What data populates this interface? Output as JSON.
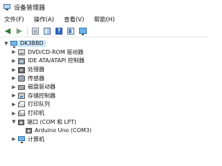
{
  "window": {
    "title": "设备管理器",
    "icon": "device-manager-icon"
  },
  "menu": [
    {
      "label": "文件(F)"
    },
    {
      "label": "操作(A)"
    },
    {
      "label": "查看(V)"
    },
    {
      "label": "帮助(H)"
    }
  ],
  "toolbar": {
    "buttons": [
      "back-arrow-icon",
      "forward-arrow-icon",
      "show-hide-tree-icon",
      "properties-icon",
      "help-icon",
      "update-driver-icon",
      "monitor-icon"
    ]
  },
  "tree": {
    "root": {
      "label": "DK3BBD",
      "expanded": true
    },
    "nodes": [
      {
        "label": "DVD/CD-ROM 驱动器",
        "expanded": false,
        "icon": "dvd-drive-icon"
      },
      {
        "label": "IDE ATA/ATAPI 控制器",
        "expanded": false,
        "icon": "ide-controller-icon"
      },
      {
        "label": "处理器",
        "expanded": false,
        "icon": "processor-icon"
      },
      {
        "label": "传感器",
        "expanded": false,
        "icon": "sensor-icon"
      },
      {
        "label": "磁盘驱动器",
        "expanded": false,
        "icon": "disk-drive-icon"
      },
      {
        "label": "存储控制器",
        "expanded": false,
        "icon": "storage-controller-icon"
      },
      {
        "label": "打印队列",
        "expanded": false,
        "icon": "print-queue-icon"
      },
      {
        "label": "打印机",
        "expanded": false,
        "icon": "printer-icon"
      },
      {
        "label": "端口 (COM 和 LPT)",
        "expanded": true,
        "icon": "port-icon",
        "children": [
          {
            "label": "Arduino Uno (COM3)",
            "icon": "arduino-port-icon"
          }
        ]
      },
      {
        "label": "计算机",
        "expanded": false,
        "icon": "computer-icon"
      }
    ]
  }
}
